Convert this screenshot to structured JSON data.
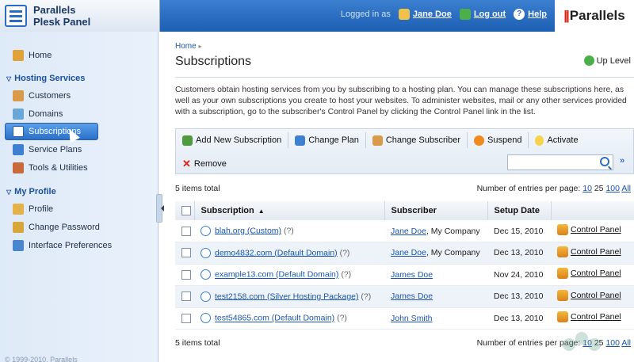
{
  "header": {
    "product_line1": "Parallels",
    "product_line2": "Plesk Panel",
    "logged_in_as_label": "Logged in as",
    "user_name": "Jane Doe",
    "logout_label": "Log out",
    "help_label": "Help",
    "brand": "Parallels"
  },
  "sidebar": {
    "home": "Home",
    "section_hosting": "Hosting Services",
    "customers": "Customers",
    "domains": "Domains",
    "subscriptions": "Subscriptions",
    "service_plans": "Service Plans",
    "tools": "Tools & Utilities",
    "section_profile": "My Profile",
    "profile": "Profile",
    "change_password": "Change Password",
    "interface_prefs": "Interface Preferences",
    "copyright": "© 1999-2010, Parallels"
  },
  "main": {
    "breadcrumb": "Home",
    "title": "Subscriptions",
    "up_level": "Up Level",
    "intro": "Customers obtain hosting services from you by subscribing to a hosting plan. You can manage these subscriptions here, as well as your own subscriptions you create to host your websites. To administer websites, mail or any other services provided with a subscription, go to the subscriber's Control Panel by clicking the Control Panel link in the list.",
    "toolbar": {
      "add": "Add New Subscription",
      "change_plan": "Change Plan",
      "change_subscriber": "Change Subscriber",
      "suspend": "Suspend",
      "activate": "Activate",
      "remove": "Remove",
      "search_value": ""
    },
    "total_top": "5 items total",
    "total_bottom": "5 items total",
    "per_page_label": "Number of entries per page:",
    "per_page_10": "10",
    "per_page_25": "25",
    "per_page_100": "100",
    "per_page_all": "All",
    "columns": {
      "subscription": "Subscription",
      "subscriber": "Subscriber",
      "setup_date": "Setup Date"
    },
    "rows": [
      {
        "name": "blah.org (Custom)",
        "hint": "(?)",
        "subscriber": "Jane Doe",
        "company": ", My Company",
        "date": "Dec 15, 2010",
        "cp": "Control Panel"
      },
      {
        "name": "demo4832.com (Default Domain)",
        "hint": "(?)",
        "subscriber": "Jane Doe",
        "company": ", My Company",
        "date": "Dec 13, 2010",
        "cp": "Control Panel"
      },
      {
        "name": "example13.com (Default Domain)",
        "hint": "(?)",
        "subscriber": "James Doe",
        "company": "",
        "date": "Nov 24, 2010",
        "cp": "Control Panel"
      },
      {
        "name": "test2158.com (Silver Hosting Package)",
        "hint": "(?)",
        "subscriber": "James Doe",
        "company": "",
        "date": "Dec 13, 2010",
        "cp": "Control Panel"
      },
      {
        "name": "test54865.com (Default Domain)",
        "hint": "(?)",
        "subscriber": "John Smith",
        "company": "",
        "date": "Dec 13, 2010",
        "cp": "Control Panel"
      }
    ]
  },
  "colors": {
    "header_blue": "#2a6cc4",
    "link_blue": "#1a56a8",
    "active_nav": "#3b84d8",
    "brand_red": "#d21111"
  }
}
